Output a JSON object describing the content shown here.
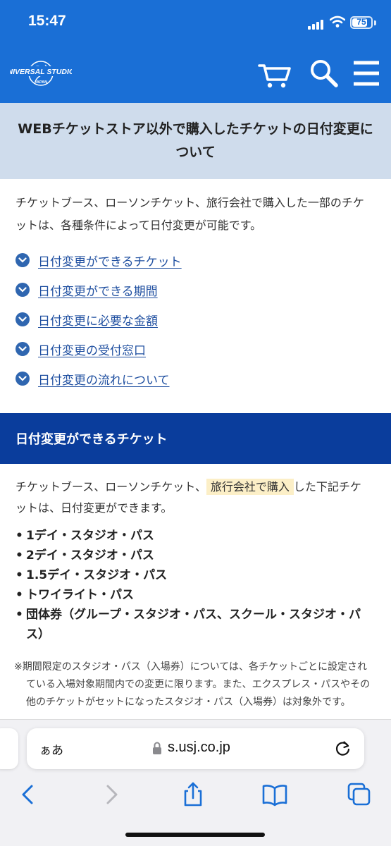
{
  "status_bar": {
    "time": "15:47",
    "battery": "75"
  },
  "header": {
    "brand": {
      "line1": "UNIVERSAL STUDIOS",
      "line2": "JAPAN"
    }
  },
  "section": {
    "title": "WEBチケットストア以外で購入したチケットの日付変更について",
    "intro": "チケットブース、ローソンチケット、旅行会社で購入した一部のチケットは、各種条件によって日付変更が可能です。",
    "toc": [
      "日付変更ができるチケット",
      "日付変更ができる期間",
      "日付変更に必要な金額",
      "日付変更の受付窓口",
      "日付変更の流れについて"
    ]
  },
  "tickets_section": {
    "title": "日付変更ができるチケット",
    "para_before": "チケットブース、ローソンチケット、",
    "para_highlight": "旅行会社で購入",
    "para_after": "した下記チケットは、日付変更ができます。",
    "items": [
      "1デイ・スタジオ・パス",
      "2デイ・スタジオ・パス",
      "1.5デイ・スタジオ・パス",
      "トワイライト・パス",
      "団体券（グループ・スタジオ・パス、スクール・スタジオ・パス）"
    ],
    "note": "※期間限定のスタジオ・パス（入場券）については、各チケットごとに設定されている入場対象期間内での変更に限ります。また、エクスプレス・パスやその他のチケットがセットになったスタジオ・パス（入場券）は対象外です。"
  },
  "browser": {
    "aa": "ぁあ",
    "url": "s.usj.co.jp"
  },
  "colors": {
    "header": "#1a6fd6",
    "band": "#0a3d9c",
    "title_bg": "#cfdcec",
    "link": "#1f4fa0",
    "highlight": "#fcefc7"
  }
}
